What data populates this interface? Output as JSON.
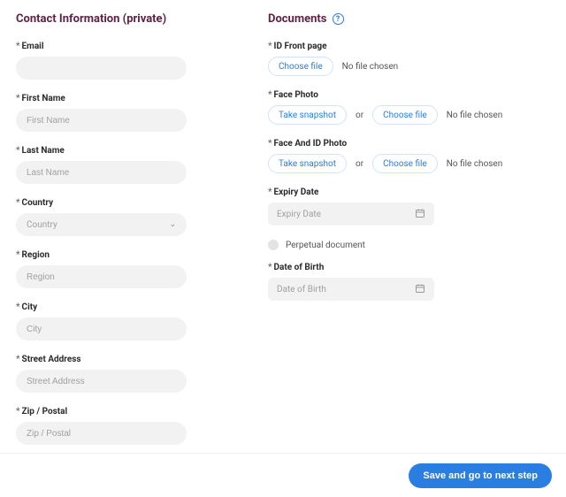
{
  "contact": {
    "title": "Contact Information (private)",
    "email_label": "Email",
    "first_name_label": "First Name",
    "first_name_placeholder": "First Name",
    "last_name_label": "Last Name",
    "last_name_placeholder": "Last Name",
    "country_label": "Country",
    "country_placeholder": "Country",
    "region_label": "Region",
    "region_placeholder": "Region",
    "city_label": "City",
    "city_placeholder": "City",
    "street_label": "Street Address",
    "street_placeholder": "Street Address",
    "zip_label": "Zip / Postal",
    "zip_placeholder": "Zip / Postal"
  },
  "documents": {
    "title": "Documents",
    "help": "?",
    "id_front_label": "ID Front page",
    "choose_file": "Choose file",
    "no_file": "No file chosen",
    "face_photo_label": "Face Photo",
    "take_snapshot": "Take snapshot",
    "or": "or",
    "face_and_id_label": "Face And ID Photo",
    "expiry_label": "Expiry Date",
    "expiry_placeholder": "Expiry Date",
    "perpetual_label": "Perpetual document",
    "dob_label": "Date of Birth",
    "dob_placeholder": "Date of Birth"
  },
  "footer": {
    "save_next": "Save and go to next step"
  },
  "required_marker": "*"
}
